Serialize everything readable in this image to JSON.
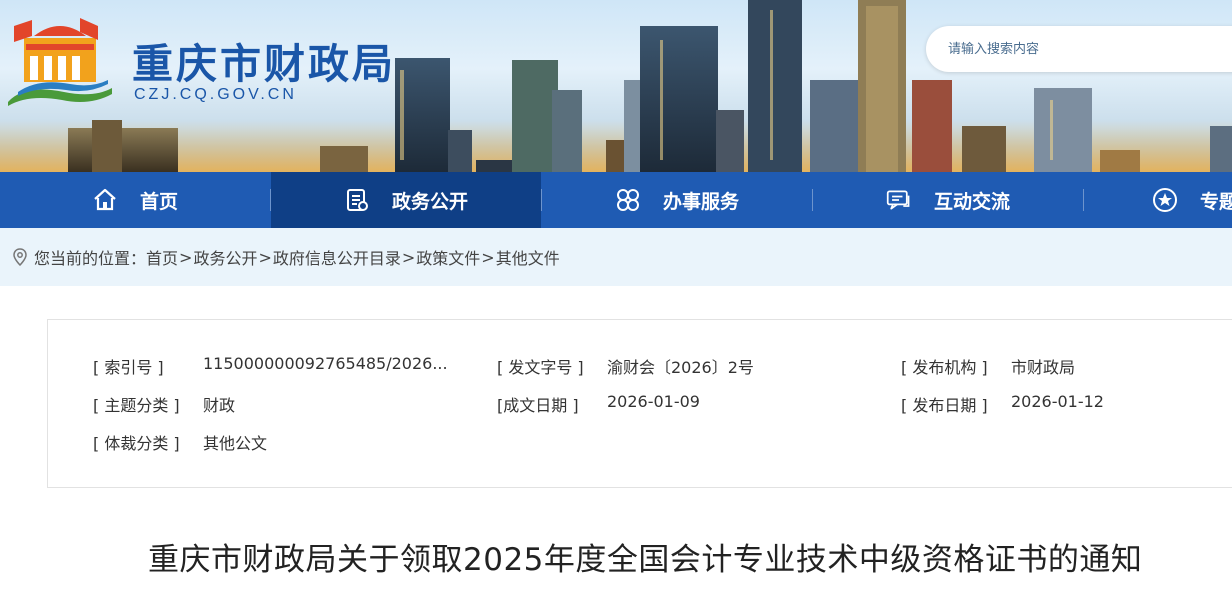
{
  "header": {
    "site_name": "重庆市财政局",
    "site_domain": "CZJ.CQ.GOV.CN",
    "search_placeholder": "请输入搜索内容"
  },
  "nav": {
    "items": [
      {
        "label": "首页",
        "icon": "home-icon",
        "active": false
      },
      {
        "label": "政务公开",
        "icon": "document-list-icon",
        "active": true
      },
      {
        "label": "办事服务",
        "icon": "grid-clover-icon",
        "active": false
      },
      {
        "label": "互动交流",
        "icon": "chat-icon",
        "active": false
      },
      {
        "label": "专题",
        "icon": "star-circle-icon",
        "active": false
      }
    ]
  },
  "breadcrumb": {
    "prefix": "您当前的位置：",
    "items": [
      "首页",
      "政务公开",
      "政府信息公开目录",
      "政策文件",
      "其他文件"
    ],
    "separator": ">"
  },
  "meta": {
    "index_no_label": "[ 索引号 ]",
    "index_no_value": "115000000092765485/2026...",
    "doc_no_label": "[ 发文字号 ]",
    "doc_no_value": "渝财会〔2026〕2号",
    "publisher_label": "[ 发布机构 ]",
    "publisher_value": "市财政局",
    "topic_label": "[ 主题分类 ]",
    "topic_value": "财政",
    "created_label": "[成文日期 ]",
    "created_value": "2026-01-09",
    "published_label": "[ 发布日期 ]",
    "published_value": "2026-01-12",
    "genre_label": "[ 体裁分类 ]",
    "genre_value": "其他公文"
  },
  "document": {
    "title": "重庆市财政局关于领取2025年度全国会计专业技术中级资格证书的通知"
  },
  "colors": {
    "nav_bg": "#1f5bb3",
    "nav_active": "#0f3f86",
    "brand_blue": "#1a56a8",
    "crumb_bg": "#eaf4fb"
  }
}
